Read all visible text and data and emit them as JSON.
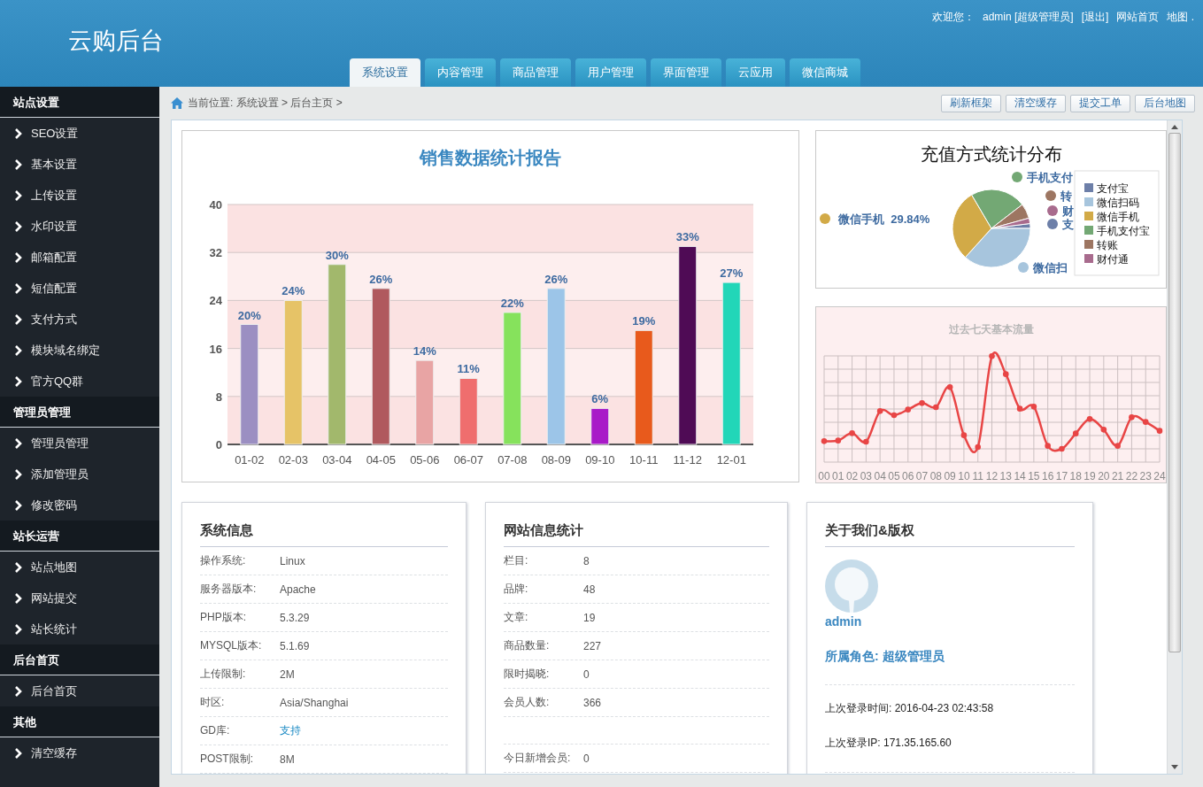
{
  "header": {
    "logo": "云购后台",
    "greeting": "欢迎您：",
    "user": "admin [超级管理员]",
    "links": [
      "[退出]",
      "网站首页",
      "地图 ."
    ]
  },
  "tabs": [
    {
      "label": "系统设置",
      "selected": true
    },
    {
      "label": "内容管理",
      "selected": false
    },
    {
      "label": "商品管理",
      "selected": false
    },
    {
      "label": "用户管理",
      "selected": false
    },
    {
      "label": "界面管理",
      "selected": false
    },
    {
      "label": "云应用",
      "selected": false
    },
    {
      "label": "微信商城",
      "selected": false
    }
  ],
  "sidebar": {
    "groups": [
      {
        "title": "站点设置",
        "items": [
          "SEO设置",
          "基本设置",
          "上传设置",
          "水印设置",
          "邮箱配置",
          "短信配置",
          "支付方式",
          "模块域名绑定",
          "官方QQ群"
        ]
      },
      {
        "title": "管理员管理",
        "items": [
          "管理员管理",
          "添加管理员",
          "修改密码"
        ]
      },
      {
        "title": "站长运营",
        "items": [
          "站点地图",
          "网站提交",
          "站长统计"
        ]
      },
      {
        "title": "后台首页",
        "items": [
          "后台首页"
        ]
      },
      {
        "title": "其他",
        "items": [
          "清空缓存"
        ]
      }
    ]
  },
  "breadcrumb": "当前位置: 系统设置 > 后台主页 >",
  "toolbar_buttons": [
    "刷新框架",
    "清空缓存",
    "提交工单",
    "后台地图"
  ],
  "sales_chart": {
    "chart_data": {
      "type": "bar",
      "title": "销售数据统计报告",
      "categories": [
        "01-02",
        "02-03",
        "03-04",
        "04-05",
        "05-06",
        "06-07",
        "07-08",
        "08-09",
        "09-10",
        "10-11",
        "11-12",
        "12-01"
      ],
      "values": [
        20,
        24,
        30,
        26,
        14,
        11,
        22,
        26,
        6,
        19,
        33,
        27
      ],
      "grid": true,
      "ylim": [
        0,
        40
      ],
      "yticks": [
        0,
        8,
        16,
        24,
        32,
        40
      ],
      "value_labels": [
        "20%",
        "24%",
        "30%",
        "26%",
        "14%",
        "11%",
        "22%",
        "26%",
        "6%",
        "19%",
        "33%",
        "27%"
      ]
    }
  },
  "pie": {
    "title": "充值方式统计分布",
    "slice_labels": [
      {
        "text": "微信手机  29.84%",
        "color": "#d2aa47"
      },
      {
        "text": "手机支付",
        "color": "#73a874"
      },
      {
        "text": "转",
        "color": "#9d7662"
      },
      {
        "text": "财",
        "color": "#a86b8d"
      },
      {
        "text": "支",
        "color": "#6d7fa8"
      },
      {
        "text": "微信扫",
        "color": "#a7c5dd"
      }
    ],
    "legend": [
      {
        "label": "支付宝",
        "color": "#6d7fa8"
      },
      {
        "label": "微信扫码",
        "color": "#a7c5dd"
      },
      {
        "label": "微信手机",
        "color": "#d2aa47"
      },
      {
        "label": "手机支付宝",
        "color": "#73a874"
      },
      {
        "label": "转账",
        "color": "#9d7662"
      },
      {
        "label": "财付通",
        "color": "#a86b8d"
      }
    ]
  },
  "traffic": {
    "title": "过去七天基本流量",
    "x_labels": [
      "00",
      "01",
      "02",
      "03",
      "04",
      "05",
      "06",
      "07",
      "08",
      "09",
      "10",
      "11",
      "12",
      "13",
      "14",
      "15",
      "16",
      "17",
      "18",
      "19",
      "20",
      "21",
      "22",
      "23",
      "24"
    ]
  },
  "system_info": {
    "title": "系统信息",
    "rows": [
      {
        "kind": "text",
        "label": "操作系统:",
        "value": "Linux"
      },
      {
        "kind": "text",
        "label": "服务器版本:",
        "value": "Apache"
      },
      {
        "kind": "text",
        "label": "PHP版本:",
        "value": "5.3.29"
      },
      {
        "kind": "text",
        "label": "MYSQL版本:",
        "value": "5.1.69"
      },
      {
        "kind": "text",
        "label": "上传限制:",
        "value": "2M"
      },
      {
        "kind": "text",
        "label": "时区:",
        "value": "Asia/Shanghai"
      },
      {
        "kind": "link",
        "label": "GD库:",
        "value": "支持"
      },
      {
        "kind": "text",
        "label": "POST限制:",
        "value": "8M"
      }
    ]
  },
  "site_stats": {
    "title": "网站信息统计",
    "rows": [
      {
        "kind": "text",
        "label": "栏目:",
        "value": "8"
      },
      {
        "kind": "text",
        "label": "品牌:",
        "value": "48"
      },
      {
        "kind": "text",
        "label": "文章:",
        "value": "19"
      },
      {
        "kind": "text",
        "label": "商品数量:",
        "value": "227"
      },
      {
        "kind": "text",
        "label": "限时揭晓:",
        "value": "0"
      },
      {
        "kind": "text",
        "label": "会员人数:",
        "value": "366"
      },
      {
        "kind": "spacer"
      },
      {
        "kind": "text",
        "label": "今日新增会员:",
        "value": "0"
      }
    ]
  },
  "about": {
    "title": "关于我们&版权",
    "username": "admin",
    "role": "所属角色: 超级管理员",
    "last_login_time": "上次登录时间: 2016-04-23 02:43:58",
    "last_login_ip": "上次登录IP: 171.35.165.60"
  }
}
